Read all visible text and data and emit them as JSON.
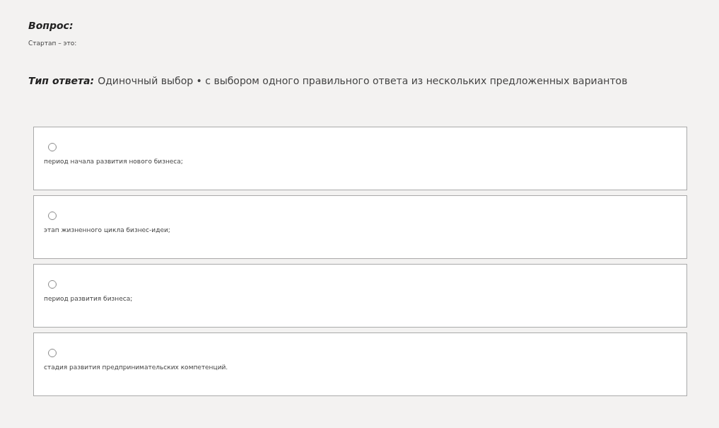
{
  "question": {
    "heading": "Вопрос:",
    "text": "Стартап – это:"
  },
  "answer_type": {
    "label": "Тип ответа:",
    "value": "Одиночный выбор • с выбором одного правильного ответа из нескольких предложенных вариантов"
  },
  "options": [
    {
      "text": "период начала развития нового бизнеса;",
      "selected": false
    },
    {
      "text": "этап жизненного цикла бизнес-идеи;",
      "selected": false
    },
    {
      "text": "период развития бизнеса;",
      "selected": false
    },
    {
      "text": "стадия развития предпринимательских компетенций.",
      "selected": false
    }
  ]
}
